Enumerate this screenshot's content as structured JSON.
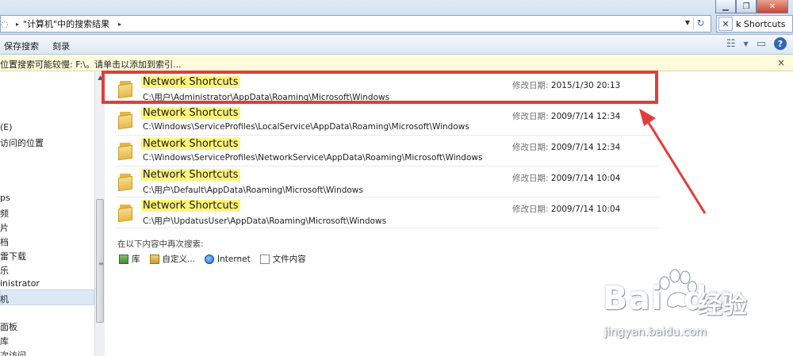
{
  "window": {
    "min_label": "▁",
    "restore_label": "❐",
    "close_label": "✕"
  },
  "address": {
    "breadcrumb": "\"计算机\"中的搜索结果"
  },
  "search": {
    "value": "k Shortcuts",
    "clear_label": "✕"
  },
  "toolbar": {
    "save_search": "保存搜索",
    "burn": "刻录",
    "help_label": "?"
  },
  "infobar": {
    "text": "位置搜索可能较慢: F:\\。请单击以添加到索引...",
    "close_label": "×"
  },
  "nav": {
    "items": [
      {
        "label": "(E)"
      },
      {
        "label": "访问的位置"
      },
      {
        "label": "ps"
      },
      {
        "label": "频"
      },
      {
        "label": "片"
      },
      {
        "label": "档"
      },
      {
        "label": "雷下载"
      },
      {
        "label": "乐"
      },
      {
        "label": "inistrator"
      },
      {
        "label": "机"
      },
      {
        "label": "面板"
      },
      {
        "label": "库"
      },
      {
        "label": "次访问"
      }
    ]
  },
  "results": {
    "date_label": "修改日期:",
    "items": [
      {
        "name": "Network Shortcuts",
        "path": "C:\\用户\\Administrator\\AppData\\Roaming\\Microsoft\\Windows",
        "date": "2015/1/30 20:13"
      },
      {
        "name": "Network Shortcuts",
        "path": "C:\\Windows\\ServiceProfiles\\LocalService\\AppData\\Roaming\\Microsoft\\Windows",
        "date": "2009/7/14 12:34"
      },
      {
        "name": "Network Shortcuts",
        "path": "C:\\Windows\\ServiceProfiles\\NetworkService\\AppData\\Roaming\\Microsoft\\Windows",
        "date": "2009/7/14 12:34"
      },
      {
        "name": "Network Shortcuts",
        "path": "C:\\用户\\Default\\AppData\\Roaming\\Microsoft\\Windows",
        "date": "2009/7/14 10:04"
      },
      {
        "name": "Network Shortcuts",
        "path": "C:\\用户\\UpdatusUser\\AppData\\Roaming\\Microsoft\\Windows",
        "date": "2009/7/14 10:04"
      }
    ]
  },
  "search_again": {
    "heading": "在以下内容中再次搜索:",
    "options": [
      {
        "label": "库",
        "icon": "library-icon"
      },
      {
        "label": "自定义...",
        "icon": "custom-folder-icon"
      },
      {
        "label": "Internet",
        "icon": "internet-explorer-icon"
      },
      {
        "label": "文件内容",
        "icon": "file-contents-icon"
      }
    ]
  },
  "watermark": {
    "brand": "Bai",
    "brand_end": "du",
    "cn": "经验",
    "url": "jingyan.baidu.com"
  },
  "colors": {
    "highlight_border": "#e23c3c",
    "name_highlight": "#fff57a",
    "info_bar": "#fffbdc"
  }
}
